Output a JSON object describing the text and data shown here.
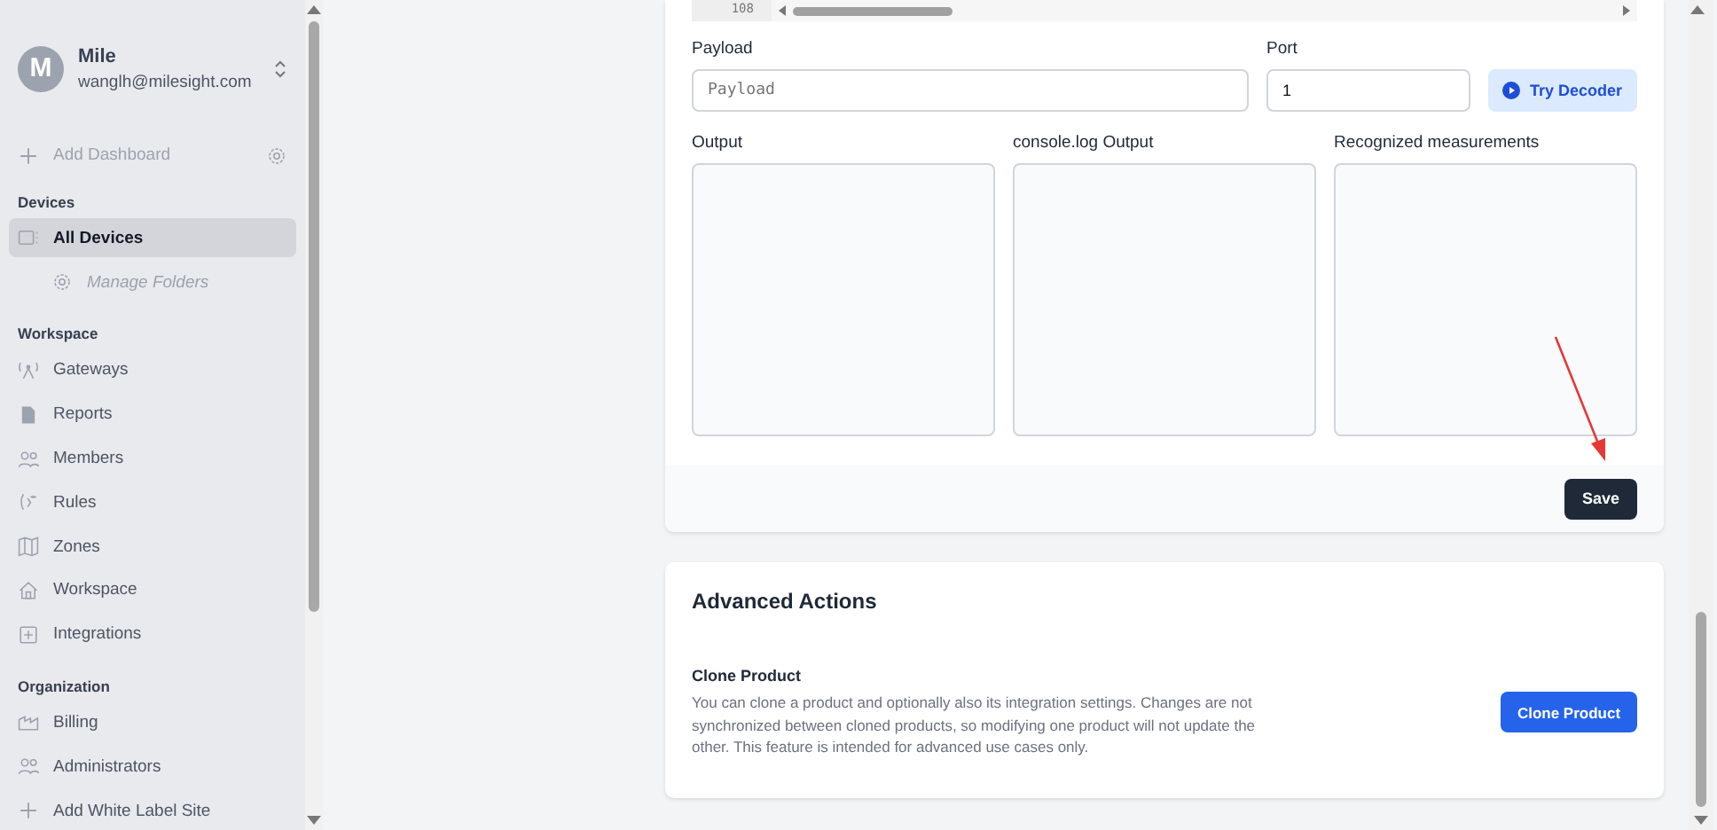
{
  "user": {
    "initial": "M",
    "name": "Mile",
    "email": "wanglh@milesight.com"
  },
  "sidebar": {
    "add_dashboard": "Add Dashboard",
    "sections": [
      {
        "title": "Devices",
        "items": [
          {
            "label": "All Devices",
            "kind": "device",
            "selected": true,
            "children": [
              {
                "label": "Manage Folders",
                "kind": "gear",
                "selected": false
              }
            ]
          }
        ]
      },
      {
        "title": "Workspace",
        "items": [
          {
            "label": "Gateways",
            "kind": "antenna",
            "selected": false
          },
          {
            "label": "Reports",
            "kind": "doc",
            "selected": false
          },
          {
            "label": "Members",
            "kind": "people",
            "selected": false
          },
          {
            "label": "Rules",
            "kind": "rule",
            "selected": false
          },
          {
            "label": "Zones",
            "kind": "map",
            "selected": false
          },
          {
            "label": "Workspace",
            "kind": "home",
            "selected": false
          },
          {
            "label": "Integrations",
            "kind": "plusbox",
            "selected": false
          }
        ]
      },
      {
        "title": "Organization",
        "items": [
          {
            "label": "Billing",
            "kind": "billing",
            "selected": false
          },
          {
            "label": "Administrators",
            "kind": "people",
            "selected": false
          },
          {
            "label": "Add White Label Site",
            "kind": "plus",
            "selected": false
          }
        ]
      }
    ]
  },
  "editor": {
    "line_number": "108"
  },
  "decoder": {
    "payload_label": "Payload",
    "payload_placeholder": "Payload",
    "port_label": "Port",
    "port_value": "1",
    "try_button": "Try Decoder",
    "outputs": [
      {
        "label": "Output"
      },
      {
        "label": "console.log Output"
      },
      {
        "label": "Recognized measurements"
      }
    ],
    "save_button": "Save"
  },
  "advanced": {
    "title": "Advanced Actions",
    "clone_title": "Clone Product",
    "clone_text": "You can clone a product and optionally also its integration settings. Changes are not synchronized between cloned products, so modifying one product will not update the other. This feature is intended for advanced use cases only.",
    "clone_button": "Clone Product"
  }
}
